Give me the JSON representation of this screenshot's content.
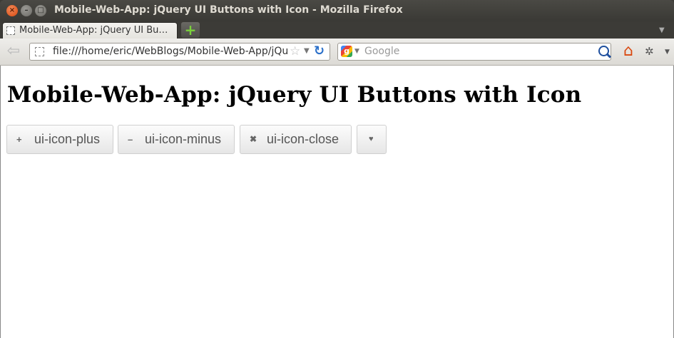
{
  "window": {
    "title": "Mobile-Web-App: jQuery UI Buttons with Icon - Mozilla Firefox",
    "controls": {
      "close": "×",
      "minimize": "–",
      "maximize": "□"
    }
  },
  "tabs": [
    {
      "label": "Mobile-Web-App: jQuery UI Bu…",
      "active": true
    }
  ],
  "toolbar": {
    "new_tab": "+",
    "url": "file:///home/eric/WebBlogs/Mobile-Web-App/jQuery",
    "search_placeholder": "Google",
    "search_engine_icon": "google-icon"
  },
  "page": {
    "heading": "Mobile-Web-App: jQuery UI Buttons with Icon",
    "buttons": [
      {
        "icon": "plus-icon",
        "glyph": "+",
        "label": "ui-icon-plus"
      },
      {
        "icon": "minus-icon",
        "glyph": "–",
        "label": "ui-icon-minus"
      },
      {
        "icon": "close-icon",
        "glyph": "✖",
        "label": "ui-icon-close"
      },
      {
        "icon": "heart-icon",
        "glyph": "♥",
        "label": ""
      }
    ]
  },
  "colors": {
    "window_chrome": "#3c3b37",
    "close_button": "#e8591a",
    "button_text": "#555555",
    "button_border": "#cfcfcf"
  }
}
